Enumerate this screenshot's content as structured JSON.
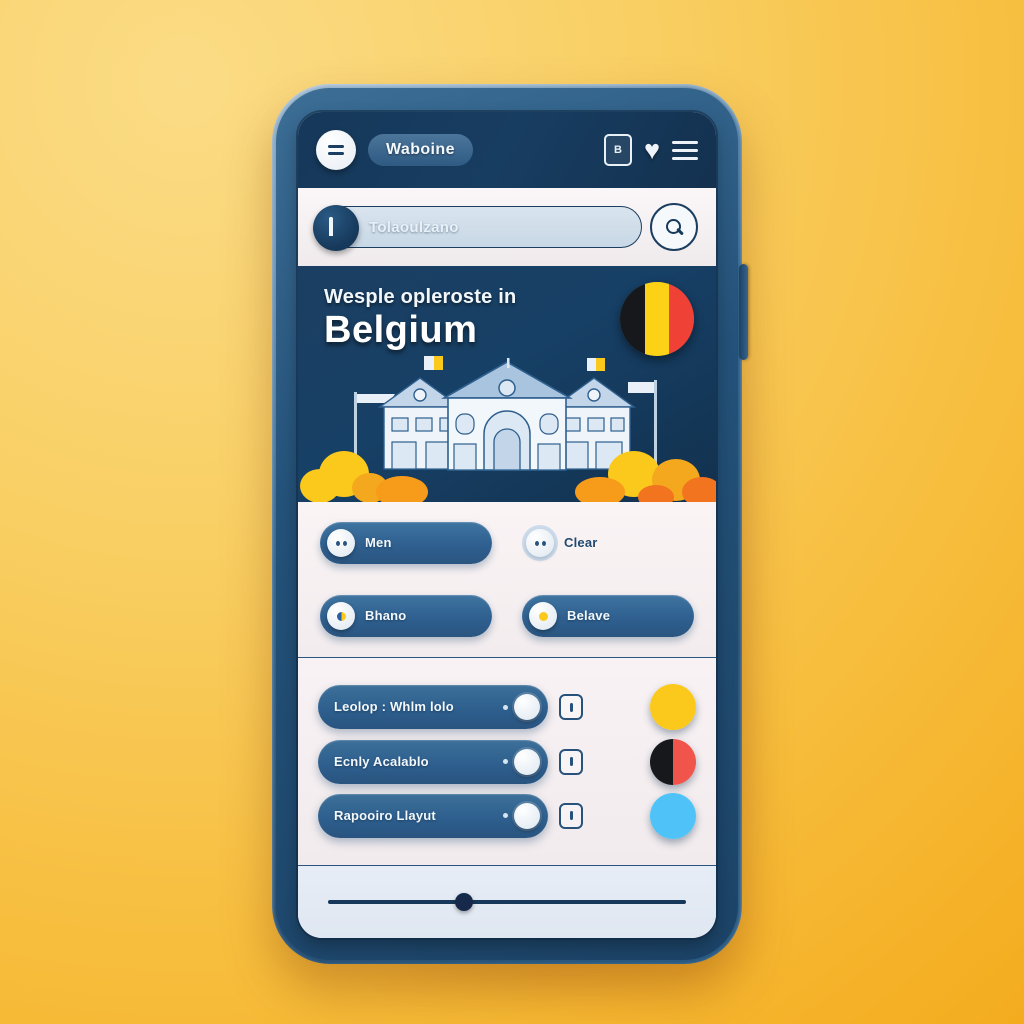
{
  "theme": {
    "background_start": "#FBDC86",
    "background_end": "#F4AC1E",
    "phone_frame": "#2E628C",
    "nav_dark": "#16385A",
    "accent_blue": "#2F6090",
    "panel_light": "#F8F2F4"
  },
  "topnav": {
    "menu_circle_icon": "equals-icon",
    "brand_label": "Waboine",
    "card_icon": "bookmark-card-icon",
    "card_glyph": "B",
    "heart_icon": "heart-icon",
    "hamburger_icon": "hamburger-menu-icon"
  },
  "search": {
    "lock_icon": "lock-icon",
    "placeholder": "Tolaoulzano",
    "value": "",
    "submit_icon": "search-icon"
  },
  "hero": {
    "subtitle": "Wesple opleroste in",
    "title": "Belgium",
    "flag_icon": "belgium-flag-icon",
    "flag_colors": [
      "#16181C",
      "#FCD116",
      "#EF4135"
    ],
    "illustration": "belgium-buildings-illustration"
  },
  "filters": {
    "rows": [
      [
        {
          "label": "Men",
          "style": "solid",
          "dot": "eyes-dot-icon",
          "dot_color": ""
        },
        {
          "label": "Clear",
          "style": "ghost",
          "dot": "eyes-dot-icon",
          "dot_color": ""
        }
      ],
      [
        {
          "label": "Bhano",
          "style": "solid",
          "dot": "blue-yellow-dot-icon",
          "dot_color": "#2B5FA0"
        },
        {
          "label": "Belave",
          "style": "solid",
          "dot": "yellow-dot-icon",
          "dot_color": "#FCD116"
        }
      ]
    ]
  },
  "list": {
    "rows": [
      {
        "label": "Leolop : Whlm lolo",
        "toggle": "on",
        "icon": "tag-badge-icon",
        "swatch_name": "yellow-swatch",
        "swatch_colors": [
          "#FBC91C",
          "#FBC91C"
        ]
      },
      {
        "label": "Ecnly Acalablo",
        "toggle": "on",
        "icon": "tag-badge-icon",
        "swatch_name": "black-red-swatch",
        "swatch_colors": [
          "#16181C",
          "#F0544B"
        ]
      },
      {
        "label": "Rapooiro Llayut",
        "toggle": "on",
        "icon": "tag-badge-icon",
        "swatch_name": "light-blue-swatch",
        "swatch_colors": [
          "#4FC3F7",
          "#4FC3F7"
        ]
      }
    ]
  },
  "bottom": {
    "slider_name": "bottom-slider",
    "slider_position_percent": 38
  }
}
